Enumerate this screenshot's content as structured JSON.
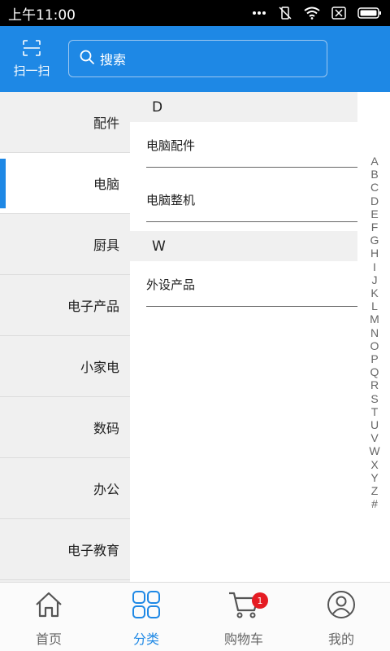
{
  "status_bar": {
    "time": "上午11:00"
  },
  "header": {
    "scan_label": "扫一扫",
    "search_placeholder": "搜索"
  },
  "categories": [
    {
      "label": "配件",
      "active": false
    },
    {
      "label": "电脑",
      "active": true
    },
    {
      "label": "厨具",
      "active": false
    },
    {
      "label": "电子产品",
      "active": false
    },
    {
      "label": "小家电",
      "active": false
    },
    {
      "label": "数码",
      "active": false
    },
    {
      "label": "办公",
      "active": false
    },
    {
      "label": "电子教育",
      "active": false
    }
  ],
  "sections": [
    {
      "letter": "D",
      "items": [
        "电脑配件",
        "电脑整机"
      ]
    },
    {
      "letter": "W",
      "items": [
        "外设产品"
      ]
    }
  ],
  "index_letters": [
    "A",
    "B",
    "C",
    "D",
    "E",
    "F",
    "G",
    "H",
    "I",
    "J",
    "K",
    "L",
    "M",
    "N",
    "O",
    "P",
    "Q",
    "R",
    "S",
    "T",
    "U",
    "V",
    "W",
    "X",
    "Y",
    "Z",
    "#"
  ],
  "bottom_nav": [
    {
      "label": "首页",
      "icon": "home-icon",
      "active": false
    },
    {
      "label": "分类",
      "icon": "category-icon",
      "active": true
    },
    {
      "label": "购物车",
      "icon": "cart-icon",
      "active": false,
      "badge": "1"
    },
    {
      "label": "我的",
      "icon": "profile-icon",
      "active": false
    }
  ],
  "colors": {
    "primary": "#1e88e5",
    "badge": "#e51c23",
    "sidebar_bg": "#f0f0f0"
  }
}
